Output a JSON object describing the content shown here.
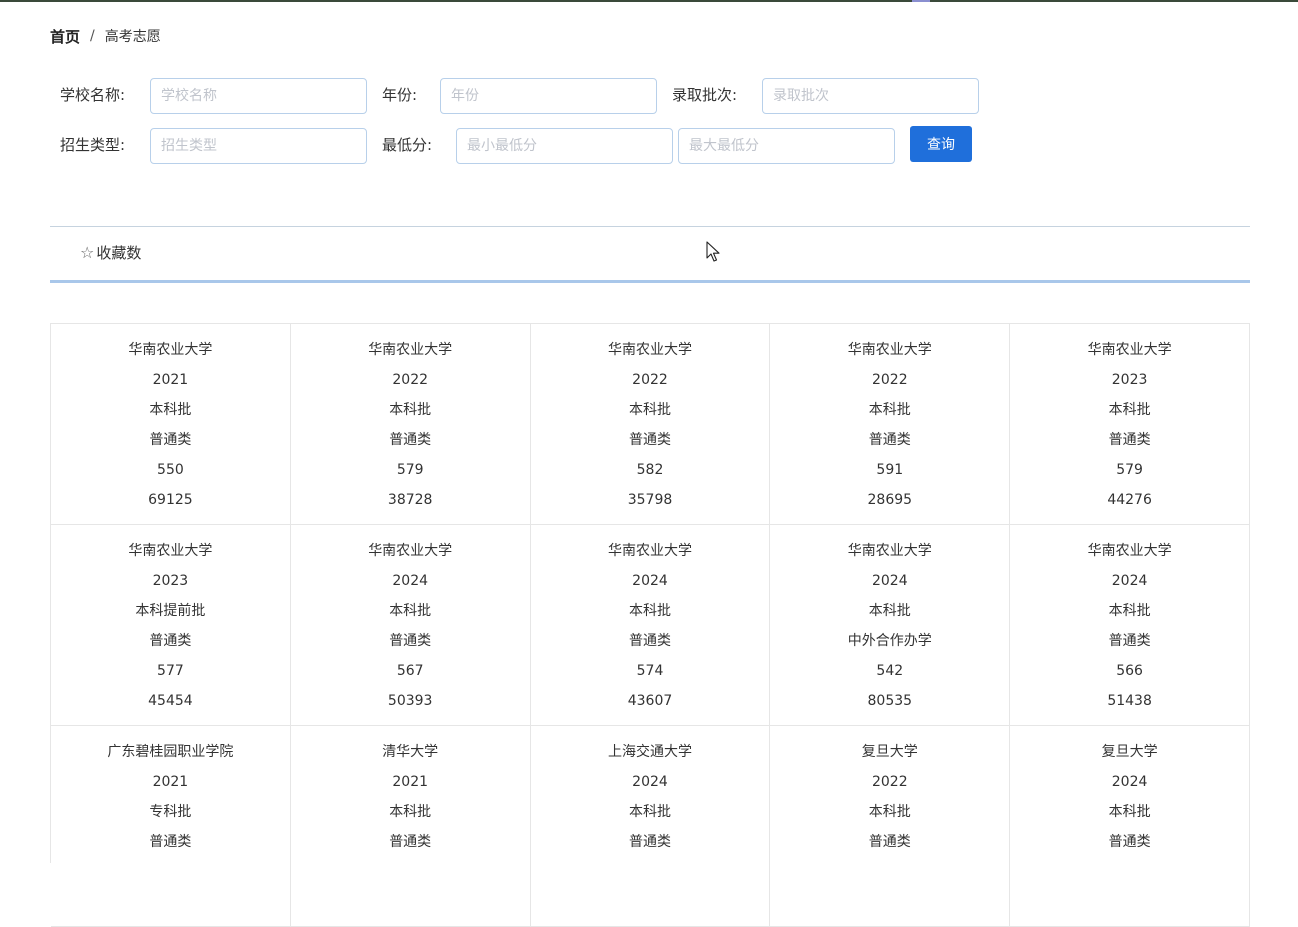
{
  "breadcrumb": {
    "home": "首页",
    "separator": "/",
    "current": "高考志愿"
  },
  "filters": {
    "school_name": {
      "label": "学校名称:",
      "placeholder": "学校名称"
    },
    "year": {
      "label": "年份:",
      "placeholder": "年份"
    },
    "batch": {
      "label": "录取批次:",
      "placeholder": "录取批次"
    },
    "enroll_type": {
      "label": "招生类型:",
      "placeholder": "招生类型"
    },
    "min_score": {
      "label": "最低分:",
      "min_placeholder": "最小最低分",
      "max_placeholder": "最大最低分"
    },
    "query_label": "查询"
  },
  "tabs": {
    "favorites_label": "收藏数",
    "favorites_icon": "star-outline-icon"
  },
  "colors": {
    "accent": "#1f6fdb",
    "tab_underline": "#a9c7ea",
    "input_border": "#b8d0ea"
  },
  "cards": [
    {
      "school": "华南农业大学",
      "year": "2021",
      "batch": "本科批",
      "type": "普通类",
      "min_score": "550",
      "rank": "69125"
    },
    {
      "school": "华南农业大学",
      "year": "2022",
      "batch": "本科批",
      "type": "普通类",
      "min_score": "579",
      "rank": "38728"
    },
    {
      "school": "华南农业大学",
      "year": "2022",
      "batch": "本科批",
      "type": "普通类",
      "min_score": "582",
      "rank": "35798"
    },
    {
      "school": "华南农业大学",
      "year": "2022",
      "batch": "本科批",
      "type": "普通类",
      "min_score": "591",
      "rank": "28695"
    },
    {
      "school": "华南农业大学",
      "year": "2023",
      "batch": "本科批",
      "type": "普通类",
      "min_score": "579",
      "rank": "44276"
    },
    {
      "school": "华南农业大学",
      "year": "2023",
      "batch": "本科提前批",
      "type": "普通类",
      "min_score": "577",
      "rank": "45454"
    },
    {
      "school": "华南农业大学",
      "year": "2024",
      "batch": "本科批",
      "type": "普通类",
      "min_score": "567",
      "rank": "50393"
    },
    {
      "school": "华南农业大学",
      "year": "2024",
      "batch": "本科批",
      "type": "普通类",
      "min_score": "574",
      "rank": "43607"
    },
    {
      "school": "华南农业大学",
      "year": "2024",
      "batch": "本科批",
      "type": "中外合作办学",
      "min_score": "542",
      "rank": "80535"
    },
    {
      "school": "华南农业大学",
      "year": "2024",
      "batch": "本科批",
      "type": "普通类",
      "min_score": "566",
      "rank": "51438"
    },
    {
      "school": "广东碧桂园职业学院",
      "year": "2021",
      "batch": "专科批",
      "type": "普通类"
    },
    {
      "school": "清华大学",
      "year": "2021",
      "batch": "本科批",
      "type": "普通类"
    },
    {
      "school": "上海交通大学",
      "year": "2024",
      "batch": "本科批",
      "type": "普通类"
    },
    {
      "school": "复旦大学",
      "year": "2022",
      "batch": "本科批",
      "type": "普通类"
    },
    {
      "school": "复旦大学",
      "year": "2024",
      "batch": "本科批",
      "type": "普通类"
    }
  ]
}
